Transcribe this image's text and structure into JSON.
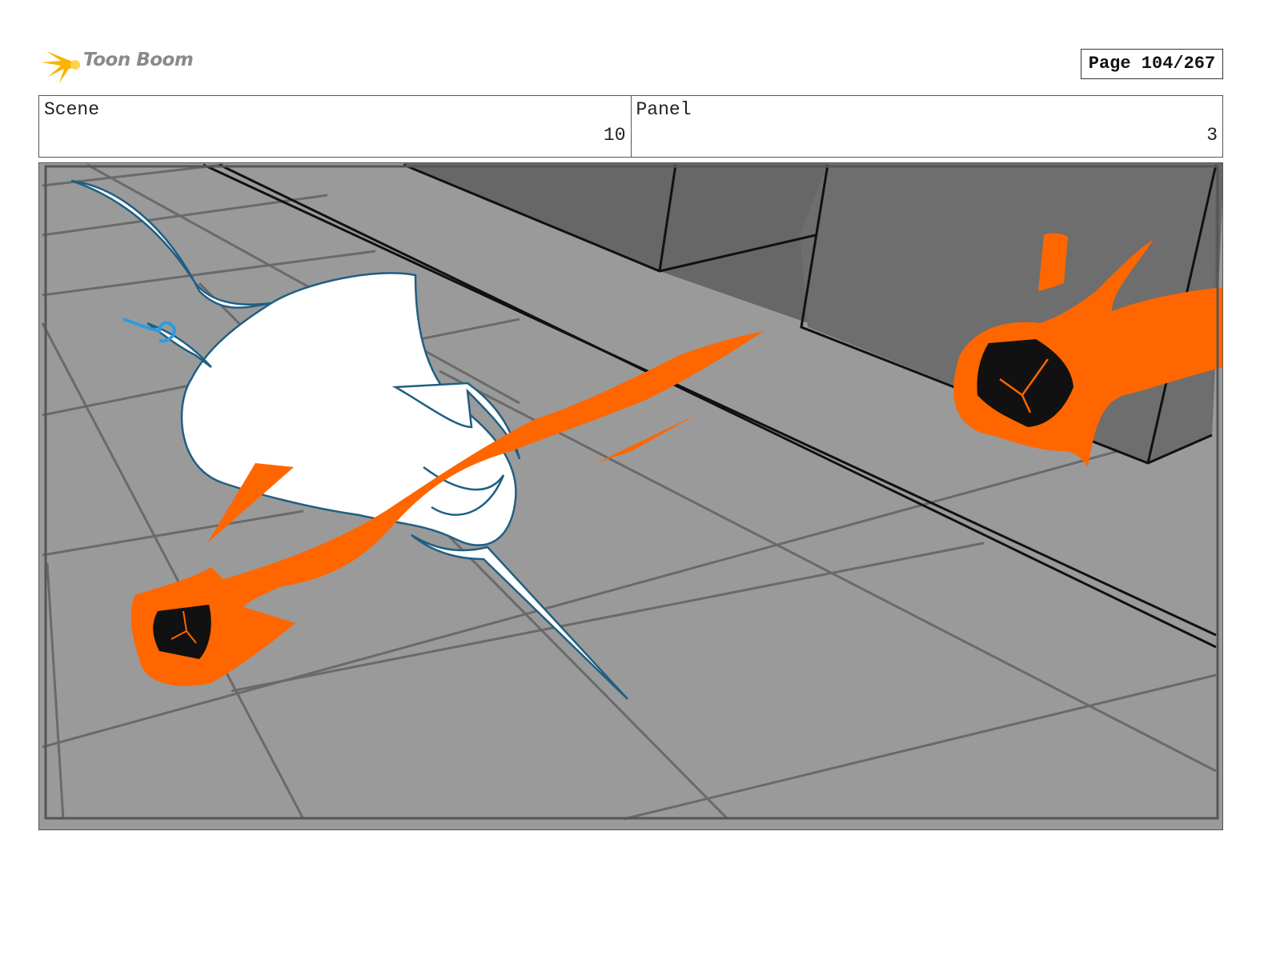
{
  "header": {
    "logo_text": "Toon Boom",
    "page_label": "Page 104/267"
  },
  "info": {
    "scene_label": "Scene",
    "scene_value": "10",
    "panel_label": "Panel",
    "panel_value": "3"
  },
  "colors": {
    "floor": "#9a9a9a",
    "wall": "#676767",
    "creature_fill": "#ffffff",
    "creature_outline": "#1f5f82",
    "flame": "#ff6600",
    "logo_accent": "#f7b500"
  }
}
